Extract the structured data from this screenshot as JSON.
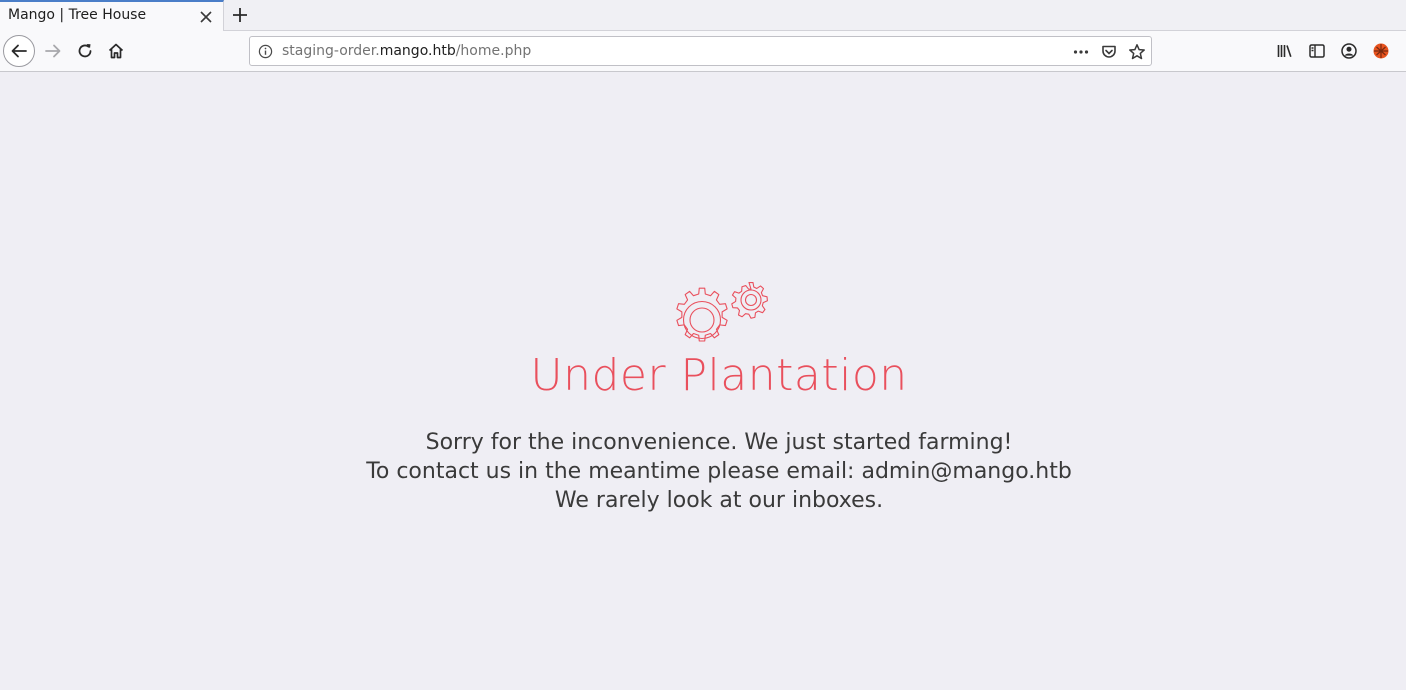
{
  "browser": {
    "tab": {
      "title": "Mango | Tree House",
      "close_icon": "close-icon"
    },
    "new_tab_icon": "plus-icon",
    "nav": {
      "back_icon": "back-arrow-icon",
      "forward_icon": "forward-arrow-icon",
      "reload_icon": "reload-icon",
      "home_icon": "home-icon"
    },
    "address": {
      "prefix": "staging-order.",
      "domain": "mango.htb",
      "path": "/home.php",
      "info_icon": "info-icon",
      "menu_icon": "more-dots-icon",
      "pocket_icon": "pocket-icon",
      "bookmark_icon": "star-icon"
    },
    "toolbar_icons": [
      "library-icon",
      "sidebar-icon",
      "account-icon",
      "extension-icon"
    ]
  },
  "page": {
    "icon": "gears-icon",
    "headline": "Under Plantation",
    "lines": [
      "Sorry for the inconvenience. We just started farming!",
      "To contact us in the meantime please email: admin@mango.htb",
      "We rarely look at our inboxes."
    ],
    "accent_color": "#e9505d"
  }
}
